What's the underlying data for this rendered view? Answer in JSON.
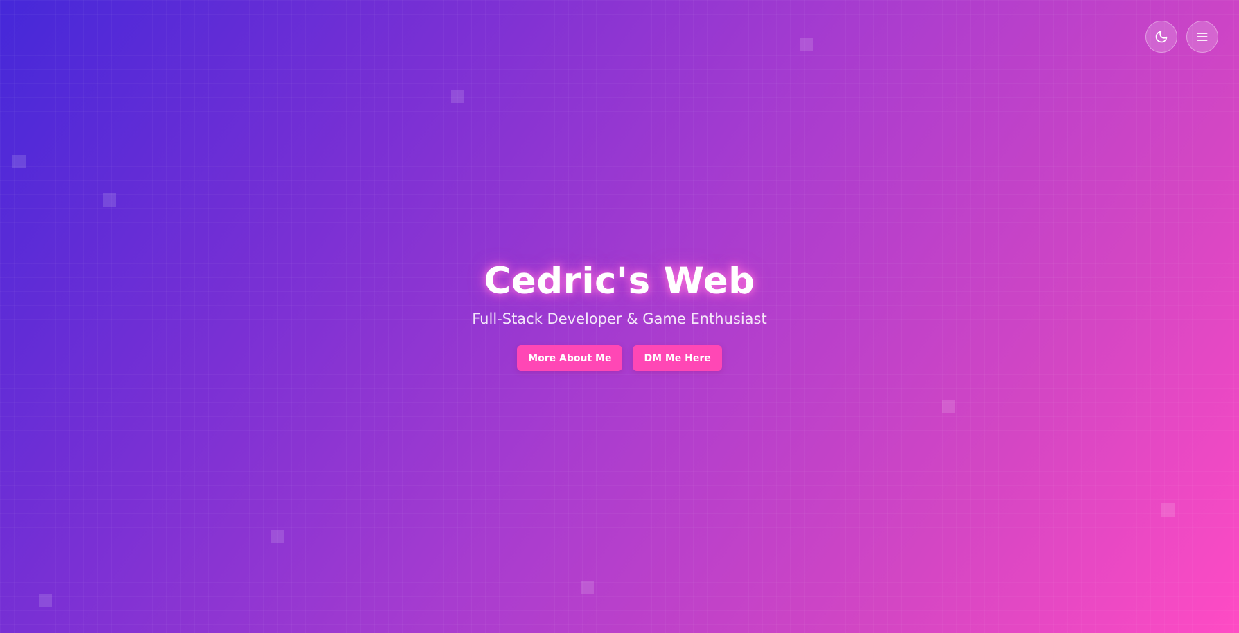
{
  "theme": {
    "gradient_start": "#4528d9",
    "gradient_end": "#ff4bc4",
    "accent": "#ff47b5"
  },
  "controls": {
    "theme_toggle_icon": "moon-icon",
    "menu_icon": "hamburger-menu-icon"
  },
  "hero": {
    "title": "Cedric's Web",
    "subtitle": "Full-Stack Developer & Game Enthusiast",
    "buttons": {
      "about_label": "More About Me",
      "dm_label": "DM Me Here"
    }
  }
}
